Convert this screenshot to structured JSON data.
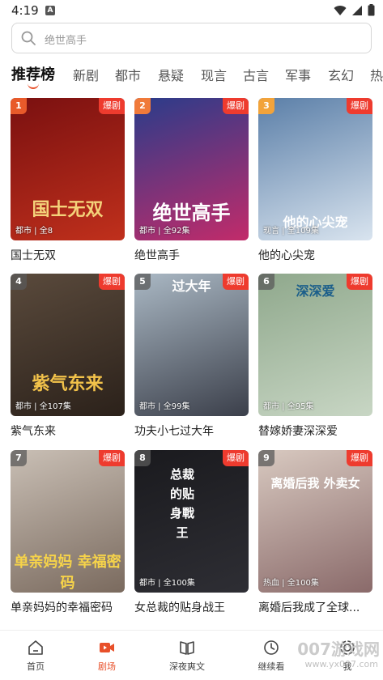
{
  "status_bar": {
    "time": "4:19",
    "notification_letter": "A"
  },
  "search": {
    "placeholder": "绝世高手"
  },
  "tabs": [
    {
      "label": "推荐榜",
      "active": true
    },
    {
      "label": "新剧"
    },
    {
      "label": "都市"
    },
    {
      "label": "悬疑"
    },
    {
      "label": "现言"
    },
    {
      "label": "古言"
    },
    {
      "label": "军事"
    },
    {
      "label": "玄幻"
    },
    {
      "label": "热"
    }
  ],
  "hot_badge": "爆剧",
  "dramas": [
    {
      "rank": "1",
      "title": "国士无双",
      "meta": "都市 | 全8",
      "poster_text": "国士无双",
      "colors": [
        "#7a1010",
        "#c0301c"
      ]
    },
    {
      "rank": "2",
      "title": "绝世高手",
      "meta": "都市 | 全92集",
      "poster_text": "绝世高手",
      "colors": [
        "#2a3c8a",
        "#c22b6a"
      ]
    },
    {
      "rank": "3",
      "title": "他的心尖宠",
      "meta": "现言 | 全109集",
      "poster_text": "他的心尖宠",
      "colors": [
        "#5b7fa8",
        "#d9e4ef"
      ]
    },
    {
      "rank": "4",
      "title": "紫气东来",
      "meta": "都市 | 全107集",
      "poster_text": "紫气东来",
      "colors": [
        "#5a4a3c",
        "#2b211a"
      ]
    },
    {
      "rank": "5",
      "title": "功夫小七过大年",
      "meta": "都市 | 全99集",
      "poster_text": "过大年",
      "colors": [
        "#aab8c4",
        "#3b3f4a"
      ]
    },
    {
      "rank": "6",
      "title": "替嫁娇妻深深爱",
      "meta": "都市 | 全95集",
      "poster_text": "深深爱",
      "colors": [
        "#8fa88c",
        "#c8d6c4"
      ]
    },
    {
      "rank": "7",
      "title": "单亲妈妈的幸福密码",
      "meta": "",
      "poster_text": "单亲妈妈 幸福密码",
      "colors": [
        "#c9bfb5",
        "#7a6a5e"
      ]
    },
    {
      "rank": "8",
      "title": "女总裁的贴身战王",
      "meta": "都市 | 全100集",
      "poster_text": "总裁的贴身戰王",
      "colors": [
        "#1a1a1e",
        "#2e2e34"
      ]
    },
    {
      "rank": "9",
      "title": "离婚后我成了全球...",
      "meta": "热血 | 全100集",
      "poster_text": "离婚后我 外卖女",
      "colors": [
        "#d8c9c0",
        "#8a6a6a"
      ]
    }
  ],
  "bottom_nav": [
    {
      "label": "首页",
      "icon": "home-icon"
    },
    {
      "label": "剧场",
      "icon": "theater-icon",
      "active": true
    },
    {
      "label": "深夜爽文",
      "icon": "book-icon"
    },
    {
      "label": "继续看",
      "icon": "clock-icon"
    },
    {
      "label": "我",
      "icon": "settings-icon"
    }
  ],
  "watermark": {
    "main": "007游戏网",
    "sub": "www.yx007.com"
  },
  "accent_color": "#e8502a",
  "hot_badge_color": "#ee3b2e"
}
